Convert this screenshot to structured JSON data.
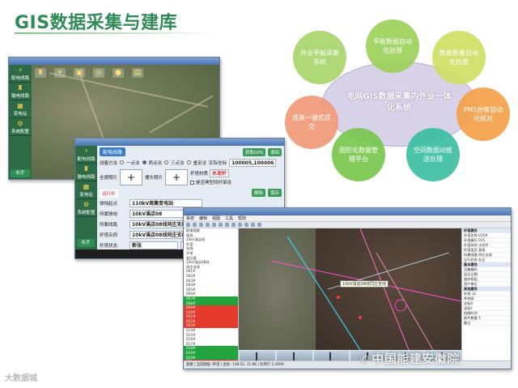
{
  "slide": {
    "title": "GIS数据采集与建库"
  },
  "venn": {
    "core": "电网GIS数据采集内外业一体化系统",
    "circles": [
      {
        "label": "外业平板采集系统",
        "color": "#a9d66b"
      },
      {
        "label": "平板数据自动化处理",
        "color": "#9ed25a"
      },
      {
        "label": "数据质量自动化检查",
        "color": "#cfe066"
      },
      {
        "label": "PMS台帐自动化核对",
        "color": "#f5a24a"
      },
      {
        "label": "空间数据动推送处理",
        "color": "#3cbfa2"
      },
      {
        "label": "图形化数据管理平台",
        "color": "#79c84f"
      },
      {
        "label": "成果一键式提交",
        "color": "#f19a78"
      }
    ]
  },
  "tablet_map": {
    "sidebar": [
      {
        "label": "配电线路",
        "icon": "pole-icon"
      },
      {
        "label": "输电线路",
        "icon": "tower-icon"
      },
      {
        "label": "变电站",
        "icon": "substation-icon"
      },
      {
        "label": "系统配置",
        "icon": "gear-icon"
      }
    ],
    "back_label": "右手"
  },
  "tablet_form": {
    "sidebar": [
      {
        "label": "配电线路",
        "icon": "pole-icon"
      },
      {
        "label": "输电线路",
        "icon": "tower-icon"
      },
      {
        "label": "变电站",
        "icon": "substation-icon"
      },
      {
        "label": "系统配置",
        "icon": "gear-icon"
      }
    ],
    "tab_name": "配电线路",
    "btn_gps": "获取GPS",
    "btn_back": "退回",
    "survey_method_label": "测量方法",
    "survey_options": [
      "一点法",
      "两点法",
      "三点法",
      "垂足法"
    ],
    "coord_label": "实际坐标",
    "coord_value": "100005,100006",
    "whole_photo_label": "全貌照片",
    "pole_photo_label": "槽头照片",
    "pole_material_label": "杆塔材质",
    "pole_material_value": "水泥杆",
    "same_pole_label": "是否典型同杆架设",
    "tabs": [
      "运行杆"
    ],
    "btn_delete": "删除",
    "btn_save": "保存",
    "start_label": "馈线起点",
    "start_value": "110kV周集变电站",
    "feeder_label": "所属馈线",
    "feeder_value": "10kV溪店08",
    "line_label": "所属线路",
    "line_value": "10kV溪店08线同庄支线",
    "pole_name_label": "杆塔名称",
    "pole_name_value": "10kV溪店08线同庄支线015#",
    "pole_no_label": "杆塔状态",
    "pole_no_value": "新张",
    "next_label": "右一",
    "back_label": "右手"
  },
  "desktop": {
    "menu": [
      "系统",
      "编辑",
      "视图",
      "工具",
      "帮助"
    ],
    "tree": [
      {
        "t": "配电线路",
        "c": ""
      },
      {
        "t": "  馈线",
        "c": ""
      },
      {
        "t": "  10kV溪店线",
        "c": ""
      },
      {
        "t": "   杆塔",
        "c": ""
      },
      {
        "t": "   导线",
        "c": ""
      },
      {
        "t": "   开关",
        "c": ""
      },
      {
        "t": "   变压器",
        "c": ""
      },
      {
        "t": "   10kV溪店08线",
        "c": ""
      },
      {
        "t": "   同庄支线",
        "c": ""
      },
      {
        "t": "   001#",
        "c": ""
      },
      {
        "t": "   002#",
        "c": ""
      },
      {
        "t": "   003#",
        "c": ""
      },
      {
        "t": "   004#",
        "c": ""
      },
      {
        "t": "   005#",
        "c": ""
      },
      {
        "t": "   006#",
        "c": ""
      },
      {
        "t": "   007#",
        "c": "g"
      },
      {
        "t": "   008#",
        "c": "g"
      },
      {
        "t": "   009#",
        "c": "r"
      },
      {
        "t": "   010#",
        "c": "r"
      },
      {
        "t": "   011#",
        "c": "r"
      },
      {
        "t": "   012#",
        "c": "r"
      },
      {
        "t": "   013#",
        "c": "r"
      },
      {
        "t": "   014#",
        "c": ""
      },
      {
        "t": "   015#",
        "c": ""
      },
      {
        "t": "   016#",
        "c": ""
      },
      {
        "t": "   017#",
        "c": ""
      },
      {
        "t": "   018#",
        "c": "g"
      },
      {
        "t": "   019#",
        "c": "g"
      },
      {
        "t": "   020#",
        "c": "g"
      },
      {
        "t": "   021#",
        "c": "r"
      },
      {
        "t": "   022#",
        "c": "r"
      },
      {
        "t": "   023#",
        "c": "r"
      },
      {
        "t": "   024#",
        "c": "r"
      },
      {
        "t": "   025#",
        "c": "g"
      },
      {
        "t": "   026#",
        "c": "r"
      }
    ],
    "map_tooltip": "10kV溪店08线同庄支线",
    "props": [
      {
        "t": "杆塔属性",
        "h": true
      },
      {
        "t": "杆塔名称 015#",
        "h": false
      },
      {
        "t": "杆塔编号 015",
        "h": false
      },
      {
        "t": "杆塔材质 水泥杆",
        "h": false
      },
      {
        "t": "杆塔类型 直线",
        "h": false
      },
      {
        "t": "所属线路 同庄支线",
        "h": false
      },
      {
        "t": "运行状态 在运",
        "h": false
      },
      {
        "t": "基本属性",
        "h": true
      },
      {
        "t": "设备编码",
        "h": false
      },
      {
        "t": "投运日期",
        "h": false
      },
      {
        "t": "维护班组",
        "h": false
      },
      {
        "t": "资产单位",
        "h": false
      },
      {
        "t": "其他属性",
        "h": true
      },
      {
        "t": "杆高 12",
        "h": false
      },
      {
        "t": "呼称高",
        "h": false
      },
      {
        "t": "坐标X",
        "h": false
      },
      {
        "t": "坐标Y",
        "h": false
      },
      {
        "t": "拍照时间",
        "h": false
      },
      {
        "t": "照片数量 5",
        "h": false
      },
      {
        "t": "备注",
        "h": false
      }
    ],
    "status": "就绪 | 当前图层: 杆塔 | 坐标: 118.52, 31.86 | 比例尺 1:2000"
  },
  "watermarks": {
    "left": "大数据城",
    "right": "中国能建安徽院"
  }
}
